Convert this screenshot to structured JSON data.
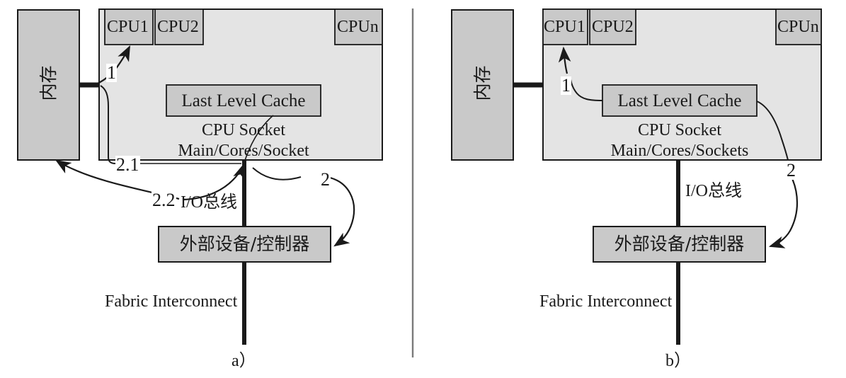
{
  "figure": {
    "type": "diagram",
    "description": "Two-panel computer architecture diagram comparing data flow paths",
    "panels": [
      {
        "id": "a",
        "caption": "a）",
        "memory_box": {
          "label": "内存"
        },
        "cpu_socket": {
          "cpus": [
            "CPU1",
            "CPU2",
            "CPUn"
          ],
          "cache": "Last Level Cache",
          "line1": "CPU Socket",
          "line2": "Main/Cores/Socket"
        },
        "io_bus_label": "I/O总线",
        "device_box": {
          "label": "外部设备/控制器"
        },
        "fabric_label": "Fabric Interconnect",
        "flow_labels": [
          "1",
          "2.1",
          "2.2",
          "2"
        ]
      },
      {
        "id": "b",
        "caption": "b）",
        "memory_box": {
          "label": "内存"
        },
        "cpu_socket": {
          "cpus": [
            "CPU1",
            "CPU2",
            "CPUn"
          ],
          "cache": "Last Level Cache",
          "line1": "CPU Socket",
          "line2": "Main/Cores/Sockets"
        },
        "io_bus_label": "I/O总线",
        "device_box": {
          "label": "外部设备/控制器"
        },
        "fabric_label": "Fabric Interconnect",
        "flow_labels": [
          "1",
          "2"
        ]
      }
    ],
    "colors": {
      "box_fill_dark": "#c9c9c9",
      "box_fill_light": "#e4e4e4",
      "stroke": "#1a1a1a",
      "background": "#ffffff",
      "divider": "#7a7a7a"
    }
  }
}
